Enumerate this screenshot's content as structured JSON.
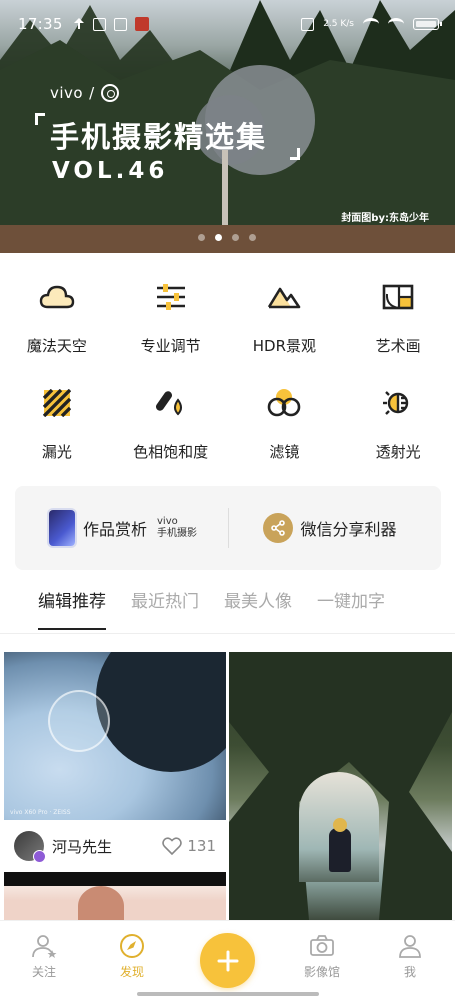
{
  "status_bar": {
    "time": "17:35",
    "signal_text": "2.5 K/s"
  },
  "hero": {
    "brand": "vivo",
    "title": "手机摄影精选集",
    "vol": "VOL.46",
    "credit": "封面图by:东岛少年",
    "page_count": 4,
    "active_page": 2
  },
  "features": [
    {
      "label": "魔法天空",
      "icon": "cloud-icon"
    },
    {
      "label": "专业调节",
      "icon": "sliders-icon"
    },
    {
      "label": "HDR景观",
      "icon": "mountain-icon"
    },
    {
      "label": "艺术画",
      "icon": "golden-ratio-icon"
    },
    {
      "label": "漏光",
      "icon": "light-leak-icon"
    },
    {
      "label": "色相饱和度",
      "icon": "hue-saturation-icon"
    },
    {
      "label": "滤镜",
      "icon": "filter-icon"
    },
    {
      "label": "透射光",
      "icon": "light-transmission-icon"
    }
  ],
  "promo": {
    "gallery_label": "作品赏析",
    "vivo_tag_line1": "vivo",
    "vivo_tag_line2": "手机摄影",
    "share_label": "微信分享利器"
  },
  "tabs": [
    {
      "label": "编辑推荐",
      "active": true
    },
    {
      "label": "最近热门",
      "active": false
    },
    {
      "label": "最美人像",
      "active": false
    },
    {
      "label": "一键加字",
      "active": false
    }
  ],
  "feed": {
    "card1": {
      "author": "河马先生",
      "likes": "131",
      "watermark": "vivo X60 Pro · ZEISS"
    }
  },
  "bottom_nav": {
    "follow": "关注",
    "discover": "发现",
    "gallery": "影像馆",
    "me": "我"
  },
  "colors": {
    "accent": "#f7c23b",
    "accent_text": "#e0b02e",
    "share_gold": "#c9a35a"
  }
}
